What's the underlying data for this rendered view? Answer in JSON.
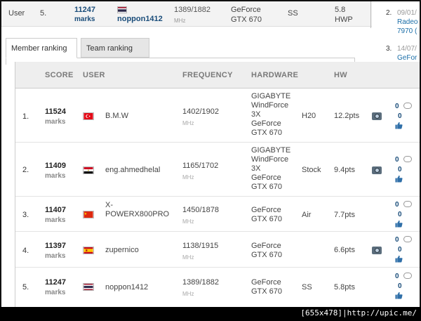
{
  "top_row": {
    "label": "User",
    "rank": "5.",
    "score": "11247",
    "marks": "marks",
    "name": "noppon1412",
    "frequency": "1389/1882",
    "mhz": "MHz",
    "hw_line1": "GeForce",
    "hw_line2": "GTX 670",
    "cooling": "SS",
    "pts": "5.8",
    "hwp": "HWP"
  },
  "side": [
    {
      "num": "2.",
      "date": "09/01/",
      "line1": "Radeo",
      "line2": "7970 ("
    },
    {
      "num": "3.",
      "date": "14/07/",
      "line1": "GeFor"
    }
  ],
  "tabs": [
    {
      "label": "Member ranking",
      "active": true
    },
    {
      "label": "Team ranking",
      "active": false
    }
  ],
  "table": {
    "headers": {
      "score": "SCORE",
      "user": "USER",
      "frequency": "FREQUENCY",
      "hardware": "HARDWARE",
      "hw": "HW"
    },
    "rows": [
      {
        "rank": "1.",
        "score": "11524",
        "marks": "marks",
        "flag": "turkey",
        "name": "B.M.W",
        "frequency": "1402/1902",
        "mhz": "MHz",
        "hardware": [
          "GIGABYTE",
          "WindForce",
          "3X",
          "GeForce",
          "GTX 670"
        ],
        "cooling": "H20",
        "pts": "12.2pts",
        "camera": true,
        "comments": "0",
        "likes": "0"
      },
      {
        "rank": "2.",
        "score": "11409",
        "marks": "marks",
        "flag": "egypt",
        "name": "eng.ahmedhelal",
        "frequency": "1165/1702",
        "mhz": "MHz",
        "hardware": [
          "GIGABYTE",
          "WindForce",
          "3X",
          "GeForce",
          "GTX 670"
        ],
        "cooling": "Stock",
        "pts": "9.4pts",
        "camera": true,
        "comments": "0",
        "likes": "0"
      },
      {
        "rank": "3.",
        "score": "11407",
        "marks": "marks",
        "flag": "china",
        "name": "X-\nPOWERX800PRO",
        "frequency": "1450/1878",
        "mhz": "MHz",
        "hardware": [
          "GeForce",
          "GTX 670"
        ],
        "cooling": "Air",
        "pts": "7.7pts",
        "camera": false,
        "comments": "0",
        "likes": "0"
      },
      {
        "rank": "4.",
        "score": "11397",
        "marks": "marks",
        "flag": "spain",
        "name": "zupernico",
        "frequency": "1138/1915",
        "mhz": "MHz",
        "hardware": [
          "GeForce",
          "GTX 670"
        ],
        "cooling": "",
        "pts": "6.6pts",
        "camera": true,
        "comments": "0",
        "likes": "0"
      },
      {
        "rank": "5.",
        "score": "11247",
        "marks": "marks",
        "flag": "thailand",
        "name": "noppon1412",
        "frequency": "1389/1882",
        "mhz": "MHz",
        "hardware": [
          "GeForce",
          "GTX 670"
        ],
        "cooling": "SS",
        "pts": "5.8pts",
        "camera": false,
        "comments": "0",
        "likes": "0"
      }
    ]
  },
  "watermark": "[655x478]|http://upic.me/",
  "colors": {
    "link": "#1a4d7a",
    "header_bg": "#eeeeee",
    "accent_blue": "#1a6ea8"
  }
}
